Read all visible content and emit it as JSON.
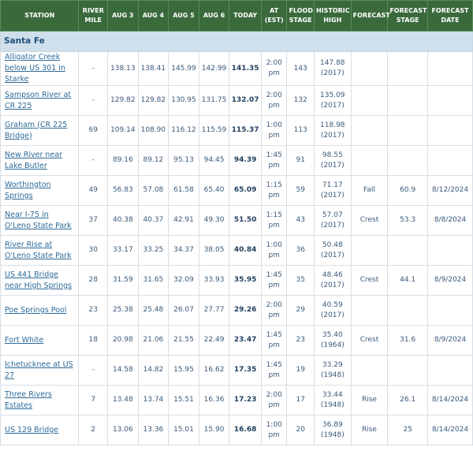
{
  "headers": {
    "station": "STATION",
    "river_mile": "RIVER MILE",
    "aug3": "AUG 3",
    "aug4": "AUG 4",
    "aug5": "AUG 5",
    "aug6": "AUG 6",
    "today": "TODAY",
    "at_est": "AT (EST)",
    "flood_stage": "FLOOD STAGE",
    "historic_high": "HISTORIC HIGH",
    "forecast": "FORECAST",
    "forecast_stage": "FORECAST STAGE",
    "forecast_date": "FORECAST DATE"
  },
  "section": "Santa Fe",
  "rows": [
    {
      "station": "Alligator Creek below US 301 in Starke",
      "mile": "-",
      "aug3": "138.13",
      "aug4": "138.41",
      "aug5": "145.99",
      "aug6": "142.99",
      "today": "141.35",
      "at": "2:00 pm",
      "flood": "143",
      "hist": "147.88 (2017)",
      "fc": "",
      "fcs": "",
      "fcd": ""
    },
    {
      "station": "Sampson River at CR 225",
      "mile": "-",
      "aug3": "129.82",
      "aug4": "129.82",
      "aug5": "130.95",
      "aug6": "131.75",
      "today": "132.07",
      "at": "2:00 pm",
      "flood": "132",
      "hist": "135.09 (2017)",
      "fc": "",
      "fcs": "",
      "fcd": ""
    },
    {
      "station": "Graham (CR 225 Bridge)",
      "mile": "69",
      "aug3": "109.14",
      "aug4": "108.90",
      "aug5": "116.12",
      "aug6": "115.59",
      "today": "115.37",
      "at": "1:00 pm",
      "flood": "113",
      "hist": "118.98 (2017)",
      "fc": "",
      "fcs": "",
      "fcd": ""
    },
    {
      "station": "New River near Lake Butler",
      "mile": "-",
      "aug3": "89.16",
      "aug4": "89.12",
      "aug5": "95.13",
      "aug6": "94.45",
      "today": "94.39",
      "at": "1:45 pm",
      "flood": "91",
      "hist": "98.55 (2017)",
      "fc": "",
      "fcs": "",
      "fcd": ""
    },
    {
      "station": "Worthington Springs",
      "mile": "49",
      "aug3": "56.83",
      "aug4": "57.08",
      "aug5": "61.58",
      "aug6": "65.40",
      "today": "65.09",
      "at": "1:15 pm",
      "flood": "59",
      "hist": "71.17 (2017)",
      "fc": "Fall",
      "fcs": "60.9",
      "fcd": "8/12/2024"
    },
    {
      "station": "Near I-75 in O'Leno State Park",
      "mile": "37",
      "aug3": "40.38",
      "aug4": "40.37",
      "aug5": "42.91",
      "aug6": "49.30",
      "today": "51.50",
      "at": "1:15 pm",
      "flood": "43",
      "hist": "57.07 (2017)",
      "fc": "Crest",
      "fcs": "53.3",
      "fcd": "8/8/2024"
    },
    {
      "station": "River Rise at O'Leno State Park",
      "mile": "30",
      "aug3": "33.17",
      "aug4": "33.25",
      "aug5": "34.37",
      "aug6": "38.05",
      "today": "40.84",
      "at": "1:00 pm",
      "flood": "36",
      "hist": "50.48 (2017)",
      "fc": "",
      "fcs": "",
      "fcd": ""
    },
    {
      "station": "US 441 Bridge near High Springs",
      "mile": "28",
      "aug3": "31.59",
      "aug4": "31.65",
      "aug5": "32.09",
      "aug6": "33.93",
      "today": "35.95",
      "at": "1:45 pm",
      "flood": "35",
      "hist": "48.46 (2017)",
      "fc": "Crest",
      "fcs": "44.1",
      "fcd": "8/9/2024"
    },
    {
      "station": "Poe Springs Pool",
      "mile": "23",
      "aug3": "25.38",
      "aug4": "25.48",
      "aug5": "26.07",
      "aug6": "27.77",
      "today": "29.26",
      "at": "2:00 pm",
      "flood": "29",
      "hist": "40.59 (2017)",
      "fc": "",
      "fcs": "",
      "fcd": ""
    },
    {
      "station": "Fort White",
      "mile": "18",
      "aug3": "20.98",
      "aug4": "21.06",
      "aug5": "21.55",
      "aug6": "22.49",
      "today": "23.47",
      "at": "1:45 pm",
      "flood": "23",
      "hist": "35.40 (1964)",
      "fc": "Crest",
      "fcs": "31.6",
      "fcd": "8/9/2024"
    },
    {
      "station": "Ichetucknee at US 27",
      "mile": "-",
      "aug3": "14.58",
      "aug4": "14.82",
      "aug5": "15.95",
      "aug6": "16.62",
      "today": "17.35",
      "at": "1:45 pm",
      "flood": "19",
      "hist": "33.29 (1948)",
      "fc": "",
      "fcs": "",
      "fcd": ""
    },
    {
      "station": "Three Rivers Estates",
      "mile": "7",
      "aug3": "13.48",
      "aug4": "13.74",
      "aug5": "15.51",
      "aug6": "16.36",
      "today": "17.23",
      "at": "2:00 pm",
      "flood": "17",
      "hist": "33.44 (1948)",
      "fc": "Rise",
      "fcs": "26.1",
      "fcd": "8/14/2024"
    },
    {
      "station": "US 129 Bridge",
      "mile": "2",
      "aug3": "13.06",
      "aug4": "13.36",
      "aug5": "15.01",
      "aug6": "15.90",
      "today": "16.68",
      "at": "1:00 pm",
      "flood": "20",
      "hist": "36.89 (1948)",
      "fc": "Rise",
      "fcs": "25",
      "fcd": "8/14/2024"
    }
  ]
}
